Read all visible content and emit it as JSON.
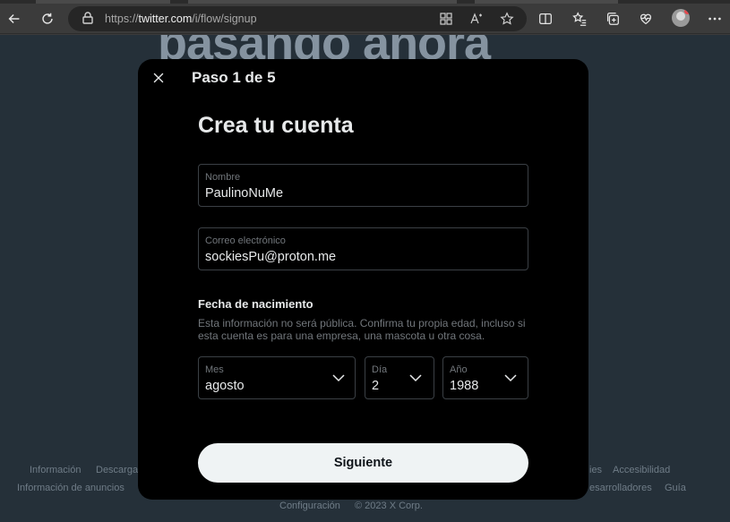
{
  "browser": {
    "url_prefix": "https://",
    "url_domain": "twitter.com",
    "url_path": "/i/flow/signup",
    "icons": [
      "back-icon",
      "refresh-icon",
      "lock-icon",
      "apps-icon",
      "read-aloud-icon",
      "favorite-star-icon",
      "split-screen-icon",
      "favorites-icon",
      "collections-icon",
      "performance-icon",
      "profile-avatar",
      "more-icon"
    ]
  },
  "background": {
    "heading": "pasando ahora",
    "footer_links": {
      "info": "Información",
      "download": "Descarga",
      "ads_info": "Información de anuncios",
      "cookies_fragment": "ies",
      "accessibility": "Accesibilidad",
      "developers_fragment": "esarrolladores",
      "guide": "Guía",
      "settings": "Configuración",
      "copyright": "© 2023 X Corp."
    }
  },
  "modal": {
    "step": "Paso 1 de 5",
    "title": "Crea tu cuenta",
    "name_field": {
      "label": "Nombre",
      "value": "PaulinoNuMe"
    },
    "email_field": {
      "label": "Correo electrónico",
      "value": "sockiesPu@proton.me"
    },
    "dob": {
      "title": "Fecha de nacimiento",
      "description": "Esta información no será pública. Confirma tu propia edad, incluso si esta cuenta es para una empresa, una mascota u otra cosa.",
      "month": {
        "label": "Mes",
        "value": "agosto"
      },
      "day": {
        "label": "Día",
        "value": "2"
      },
      "year": {
        "label": "Año",
        "value": "1988"
      }
    },
    "next_label": "Siguiente"
  },
  "colors": {
    "page_bg": "#253039",
    "modal_bg": "#000000",
    "button_bg": "#eff3f4",
    "muted_text": "#71767b"
  }
}
